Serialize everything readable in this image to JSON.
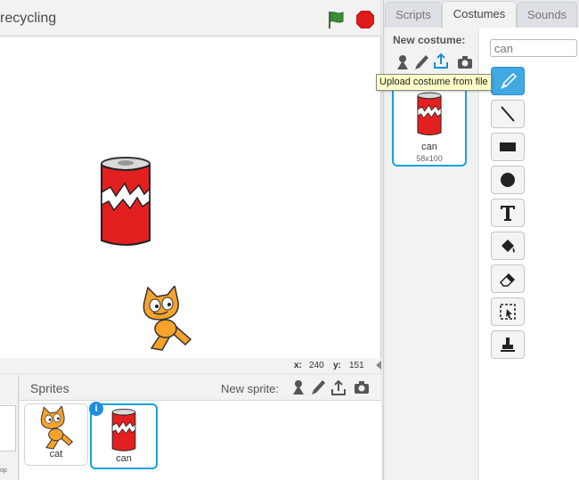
{
  "project": {
    "title": "recycling"
  },
  "stage": {
    "coords": {
      "x_label": "x:",
      "x_value": "240",
      "y_label": "y:",
      "y_value": "151"
    },
    "stage_thumb_caption": "op"
  },
  "sprites_pane": {
    "title": "Sprites",
    "new_sprite_label": "New sprite:",
    "info_badge": "i",
    "items": [
      {
        "name": "cat"
      },
      {
        "name": "can"
      }
    ]
  },
  "tabs": [
    {
      "label": "Scripts"
    },
    {
      "label": "Costumes"
    },
    {
      "label": "Sounds"
    }
  ],
  "costumes": {
    "new_costume_label": "New costume:",
    "tooltip": "Upload costume from file",
    "items": [
      {
        "name": "can",
        "size": "58x100"
      }
    ],
    "name_field_value": "can"
  },
  "icons": {
    "flag": "green-flag-icon",
    "stop": "stop-icon",
    "library": "sprite-library-icon",
    "paint": "paint-brush-icon",
    "upload": "upload-icon",
    "camera": "camera-icon"
  },
  "colors": {
    "accent": "#1aa0e0",
    "flag": "#3e8b3a",
    "stop": "#e01b1b",
    "active_tool": "#41a8e2",
    "tooltip_bg": "#ffffc8"
  }
}
